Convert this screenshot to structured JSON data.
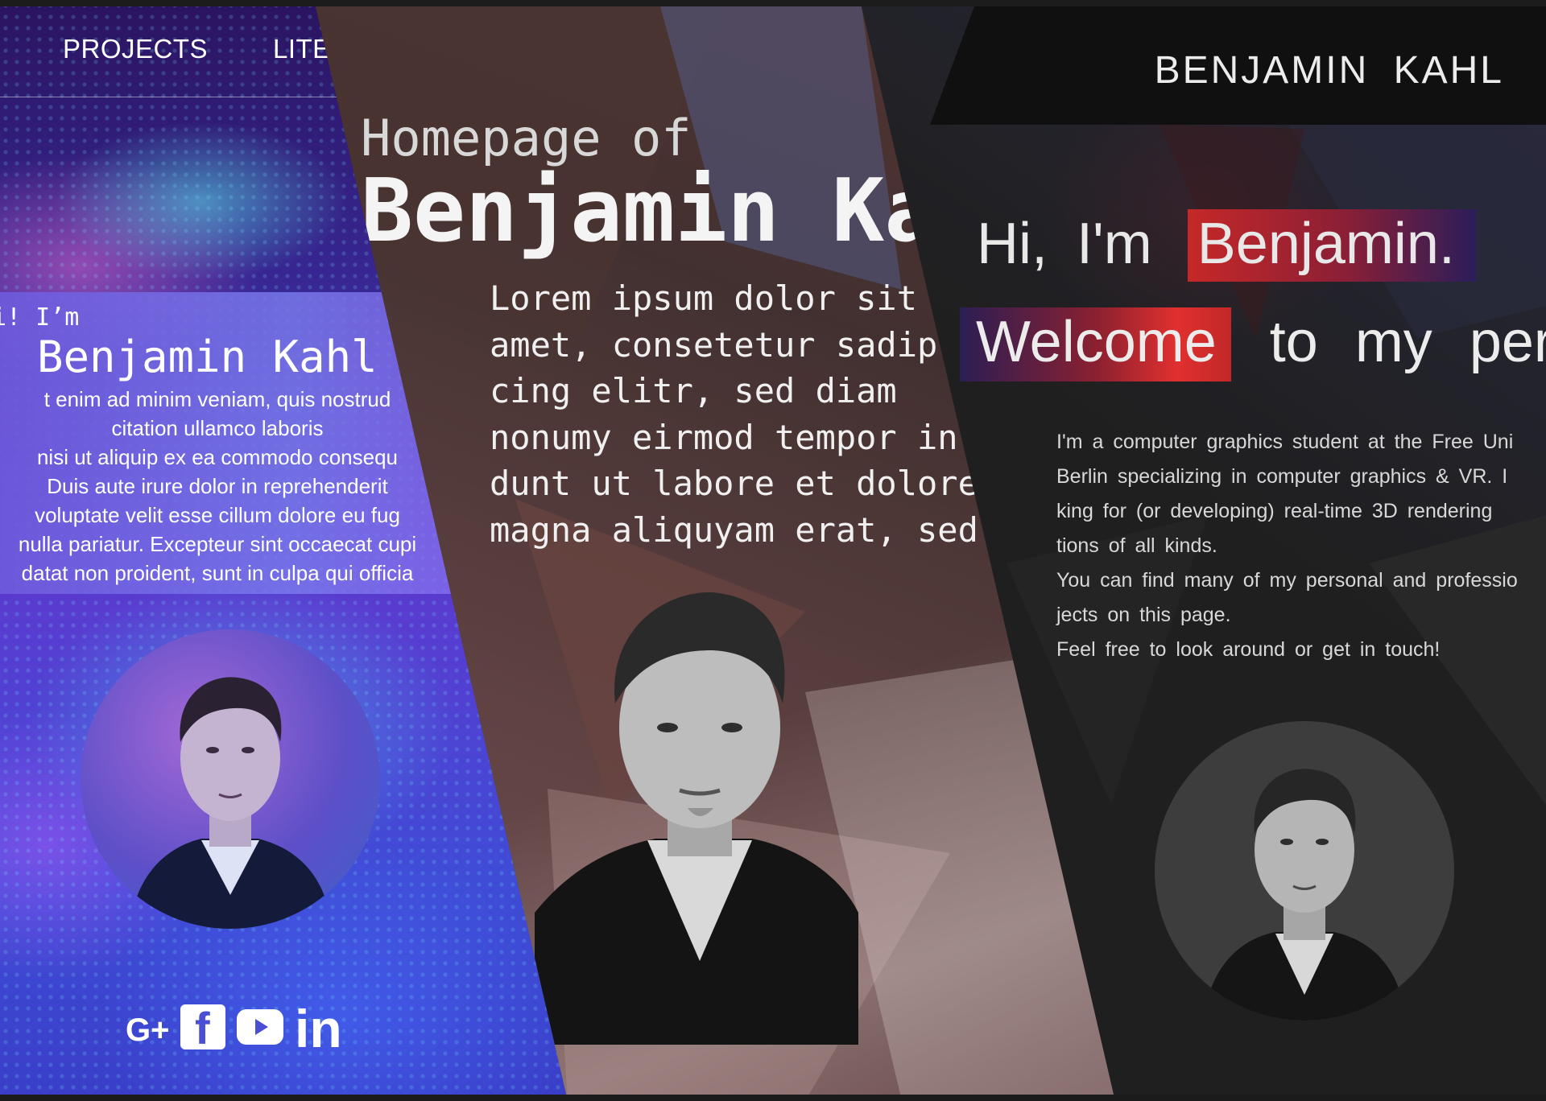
{
  "blue_site": {
    "nav": {
      "projects": "PROJECTS",
      "literature": "LITE"
    },
    "greeting": "i! I’m",
    "name": "Benjamin Kahl",
    "body_lines": [
      "t enim ad minim veniam, quis nostrud",
      "citation ullamco laboris",
      "nisi ut aliquip ex ea commodo consequ",
      "Duis aute irure dolor in reprehenderit",
      "voluptate velit esse cillum dolore eu fug",
      "nulla pariatur. Excepteur sint occaecat cupi",
      "datat non proident, sunt in culpa qui officia"
    ],
    "social": {
      "google_plus": "G+",
      "facebook": "f",
      "linkedin": "in"
    }
  },
  "mono_site": {
    "subtitle": "Homepage of",
    "title": "Benjamin Ka",
    "body_lines": [
      "Lorem ipsum dolor sit",
      "amet, consetetur sadip.",
      "cing elitr, sed diam",
      "nonumy eirmod tempor in",
      "dunt ut labore et dolore",
      "magna aliquyam erat, sed"
    ]
  },
  "dark_site": {
    "brand": "BENJAMIN KAHL",
    "hi": "Hi, I'm",
    "name_highlight": "Benjamin.",
    "welcome_highlight": "Welcome",
    "welcome_rest": "to my pers",
    "body_lines": [
      "I'm a computer graphics student at the Free Uni",
      "Berlin specializing in computer graphics & VR. I",
      "king for (or developing) real-time 3D rendering",
      "tions of all kinds.",
      "You can find many of my personal and professio",
      "jects on this page.",
      "Feel free to look around or get in touch!"
    ]
  },
  "colors": {
    "blue_bg": "#3a2a9c",
    "accent_red": "#e0302f",
    "accent_navy": "#2b1e54",
    "dark_bg": "#1f1f1f"
  }
}
